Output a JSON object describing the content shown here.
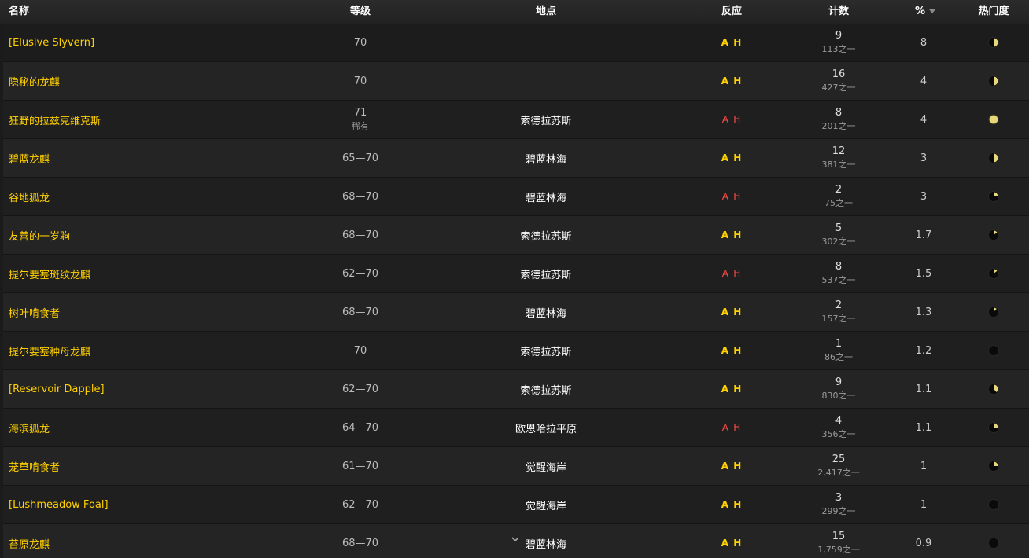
{
  "columns": {
    "name": "名称",
    "level": "等级",
    "location": "地点",
    "reaction": "反应",
    "count": "计数",
    "percent": "%",
    "popularity": "热门度"
  },
  "colors": {
    "accent": "#ffd100",
    "hostile": "#ff4b4b",
    "popularity_fill": "#e6d77a",
    "row_even": "#1f1f1f",
    "row_odd": "#242424"
  },
  "icons": {
    "sort": "sort-down-icon",
    "popularity": "popularity-pie-icon",
    "expand": "chevron-down-icon"
  },
  "rows": [
    {
      "name": "[Elusive Slyvern]",
      "level": "70",
      "level_note": "",
      "location": "",
      "reaction_a": "A",
      "reaction_h": "H",
      "reaction_hostile": false,
      "count": "9",
      "count_total": "113之一",
      "percent": "8",
      "popularity": 0.5
    },
    {
      "name": "隐秘的龙麒",
      "level": "70",
      "level_note": "",
      "location": "",
      "reaction_a": "A",
      "reaction_h": "H",
      "reaction_hostile": false,
      "count": "16",
      "count_total": "427之一",
      "percent": "4",
      "popularity": 0.5
    },
    {
      "name": "狂野的拉兹克维克斯",
      "level": "71",
      "level_note": "稀有",
      "location": "索德拉苏斯",
      "reaction_a": "A",
      "reaction_h": "H",
      "reaction_hostile": true,
      "count": "8",
      "count_total": "201之一",
      "percent": "4",
      "popularity": 1.0
    },
    {
      "name": "碧蓝龙麒",
      "level": "65—70",
      "level_note": "",
      "location": "碧蓝林海",
      "reaction_a": "A",
      "reaction_h": "H",
      "reaction_hostile": false,
      "count": "12",
      "count_total": "381之一",
      "percent": "3",
      "popularity": 0.5
    },
    {
      "name": "谷地狐龙",
      "level": "68—70",
      "level_note": "",
      "location": "碧蓝林海",
      "reaction_a": "A",
      "reaction_h": "H",
      "reaction_hostile": true,
      "count": "2",
      "count_total": "75之一",
      "percent": "3",
      "popularity": 0.25
    },
    {
      "name": "友善的一岁驹",
      "level": "68—70",
      "level_note": "",
      "location": "索德拉苏斯",
      "reaction_a": "A",
      "reaction_h": "H",
      "reaction_hostile": false,
      "count": "5",
      "count_total": "302之一",
      "percent": "1.7",
      "popularity": 0.15
    },
    {
      "name": "提尔要塞斑纹龙麒",
      "level": "62—70",
      "level_note": "",
      "location": "索德拉苏斯",
      "reaction_a": "A",
      "reaction_h": "H",
      "reaction_hostile": true,
      "count": "8",
      "count_total": "537之一",
      "percent": "1.5",
      "popularity": 0.15
    },
    {
      "name": "树叶啃食者",
      "level": "68—70",
      "level_note": "",
      "location": "碧蓝林海",
      "reaction_a": "A",
      "reaction_h": "H",
      "reaction_hostile": false,
      "count": "2",
      "count_total": "157之一",
      "percent": "1.3",
      "popularity": 0.12
    },
    {
      "name": "提尔要塞种母龙麒",
      "level": "70",
      "level_note": "",
      "location": "索德拉苏斯",
      "reaction_a": "A",
      "reaction_h": "H",
      "reaction_hostile": false,
      "count": "1",
      "count_total": "86之一",
      "percent": "1.2",
      "popularity": 0.0
    },
    {
      "name": "[Reservoir Dapple]",
      "level": "62—70",
      "level_note": "",
      "location": "索德拉苏斯",
      "reaction_a": "A",
      "reaction_h": "H",
      "reaction_hostile": false,
      "count": "9",
      "count_total": "830之一",
      "percent": "1.1",
      "popularity": 0.38
    },
    {
      "name": "海滨狐龙",
      "level": "64—70",
      "level_note": "",
      "location": "欧恩哈拉平原",
      "reaction_a": "A",
      "reaction_h": "H",
      "reaction_hostile": true,
      "count": "4",
      "count_total": "356之一",
      "percent": "1.1",
      "popularity": 0.25
    },
    {
      "name": "茏草啃食者",
      "level": "61—70",
      "level_note": "",
      "location": "觉醒海岸",
      "reaction_a": "A",
      "reaction_h": "H",
      "reaction_hostile": false,
      "count": "25",
      "count_total": "2,417之一",
      "percent": "1",
      "popularity": 0.25
    },
    {
      "name": "[Lushmeadow Foal]",
      "level": "62—70",
      "level_note": "",
      "location": "觉醒海岸",
      "reaction_a": "A",
      "reaction_h": "H",
      "reaction_hostile": false,
      "count": "3",
      "count_total": "299之一",
      "percent": "1",
      "popularity": 0.0
    },
    {
      "name": "苔原龙麒",
      "level": "68—70",
      "level_note": "",
      "location": "碧蓝林海",
      "reaction_a": "A",
      "reaction_h": "H",
      "reaction_hostile": false,
      "count": "15",
      "count_total": "1,759之一",
      "percent": "0.9",
      "popularity": 0.0
    }
  ]
}
